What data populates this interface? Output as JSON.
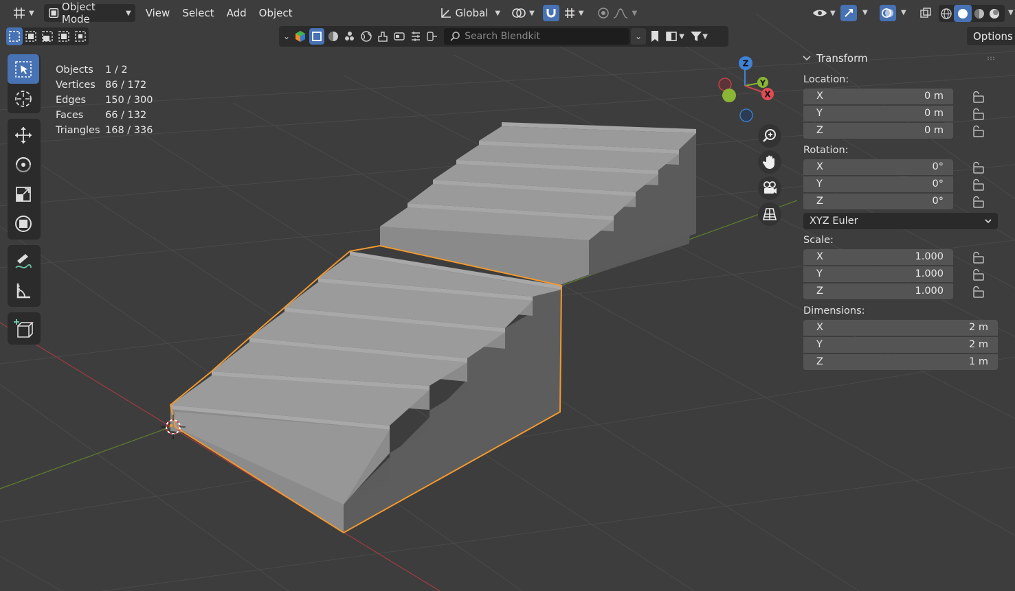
{
  "header": {
    "mode_label": "Object Mode",
    "menus": [
      "View",
      "Select",
      "Add",
      "Object"
    ],
    "orientation_label": "Global"
  },
  "filter": {
    "search_placeholder": "Search Blendkit"
  },
  "options_label": "Options",
  "stats": [
    {
      "label": "Objects",
      "value": "1 / 2"
    },
    {
      "label": "Vertices",
      "value": "86 / 172"
    },
    {
      "label": "Edges",
      "value": "150 / 300"
    },
    {
      "label": "Faces",
      "value": "66 / 132"
    },
    {
      "label": "Triangles",
      "value": "168 / 336"
    }
  ],
  "gizmo": {
    "x": "X",
    "y": "Y",
    "z": "Z"
  },
  "transform": {
    "title": "Transform",
    "location_label": "Location:",
    "location": [
      {
        "axis": "X",
        "value": "0 m"
      },
      {
        "axis": "Y",
        "value": "0 m"
      },
      {
        "axis": "Z",
        "value": "0 m"
      }
    ],
    "rotation_label": "Rotation:",
    "rotation": [
      {
        "axis": "X",
        "value": "0°"
      },
      {
        "axis": "Y",
        "value": "0°"
      },
      {
        "axis": "Z",
        "value": "0°"
      }
    ],
    "rotation_mode": "XYZ Euler",
    "scale_label": "Scale:",
    "scale": [
      {
        "axis": "X",
        "value": "1.000"
      },
      {
        "axis": "Y",
        "value": "1.000"
      },
      {
        "axis": "Z",
        "value": "1.000"
      }
    ],
    "dimensions_label": "Dimensions:",
    "dimensions": [
      {
        "axis": "X",
        "value": "2 m"
      },
      {
        "axis": "Y",
        "value": "2 m"
      },
      {
        "axis": "Z",
        "value": "1 m"
      }
    ]
  },
  "colors": {
    "accent": "#4772b3",
    "selection_outline": "#f2992e",
    "axis_x": "#d0454e",
    "axis_y": "#8ab535",
    "axis_z": "#3f83d6"
  }
}
